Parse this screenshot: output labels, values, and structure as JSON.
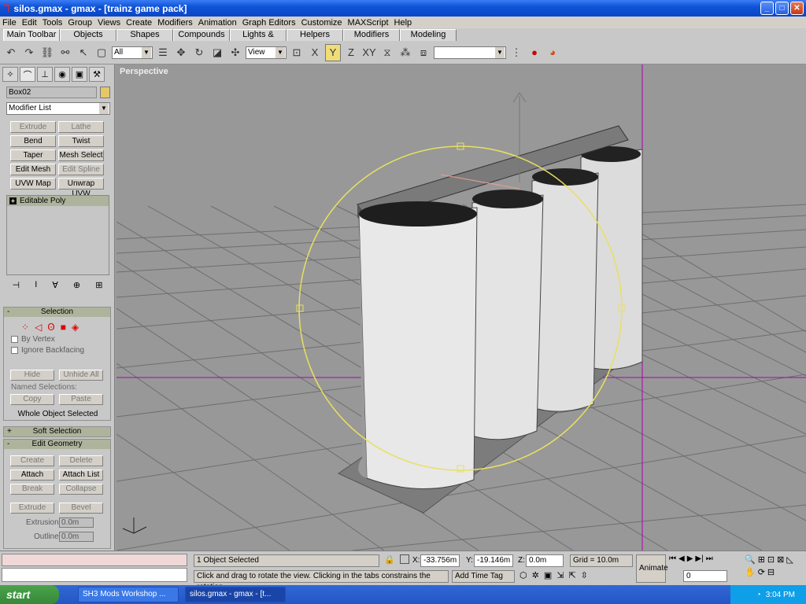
{
  "window": {
    "title": "silos.gmax - gmax - [trainz game pack]",
    "min": "_",
    "max": "□",
    "close": "✕"
  },
  "menu": [
    "File",
    "Edit",
    "Tools",
    "Group",
    "Views",
    "Create",
    "Modifiers",
    "Animation",
    "Graph Editors",
    "Customize",
    "MAXScript",
    "Help"
  ],
  "tabs": [
    "Main Toolbar",
    "Objects",
    "Shapes",
    "Compounds",
    "Lights & Cameras",
    "Helpers",
    "Modifiers",
    "Modeling"
  ],
  "toolbar": {
    "selection_filter": "All",
    "ref_coord": "View",
    "named_set": ""
  },
  "command_panel": {
    "object_name": "Box02",
    "modifier_list": "Modifier List",
    "modifier_buttons": [
      "Extrude",
      "Lathe",
      "Bend",
      "Twist",
      "Taper",
      "Mesh Select",
      "Edit Mesh",
      "Edit Spline",
      "UVW Map",
      "Unwrap UVW"
    ],
    "stack_item": "Editable Poly",
    "selection": {
      "title": "Selection",
      "by_vertex": "By Vertex",
      "ignore_backfacing": "Ignore Backfacing",
      "hide": "Hide",
      "unhide_all": "Unhide All",
      "named_selections": "Named Selections:",
      "copy": "Copy",
      "paste": "Paste",
      "status": "Whole Object Selected"
    },
    "soft_selection": "Soft Selection",
    "edit_geometry": {
      "title": "Edit Geometry",
      "create": "Create",
      "delete": "Delete",
      "attach": "Attach",
      "attach_list": "Attach List",
      "break": "Break",
      "collapse": "Collapse",
      "extrude": "Extrude",
      "bevel": "Bevel",
      "extrusion_label": "Extrusion:",
      "extrusion_value": "0.0m",
      "outline_label": "Outline:",
      "outline_value": "0.0m"
    }
  },
  "viewport": {
    "label": "Perspective"
  },
  "status": {
    "selected": "1 Object Selected",
    "x_label": "X:",
    "x": "-33.756m",
    "y_label": "Y:",
    "y": "-19.146m",
    "z_label": "Z:",
    "z": "0.0m",
    "grid": "Grid = 10.0m",
    "prompt": "Click and drag to rotate the view.  Clicking in the tabs constrains the rotation",
    "time_tag": "Add Time Tag",
    "animate": "Animate",
    "frame": "0"
  },
  "taskbar": {
    "start": "start",
    "tasks": [
      "SH3 Mods Workshop ...",
      "silos.gmax - gmax - [t..."
    ],
    "clock": "3:04 PM"
  }
}
